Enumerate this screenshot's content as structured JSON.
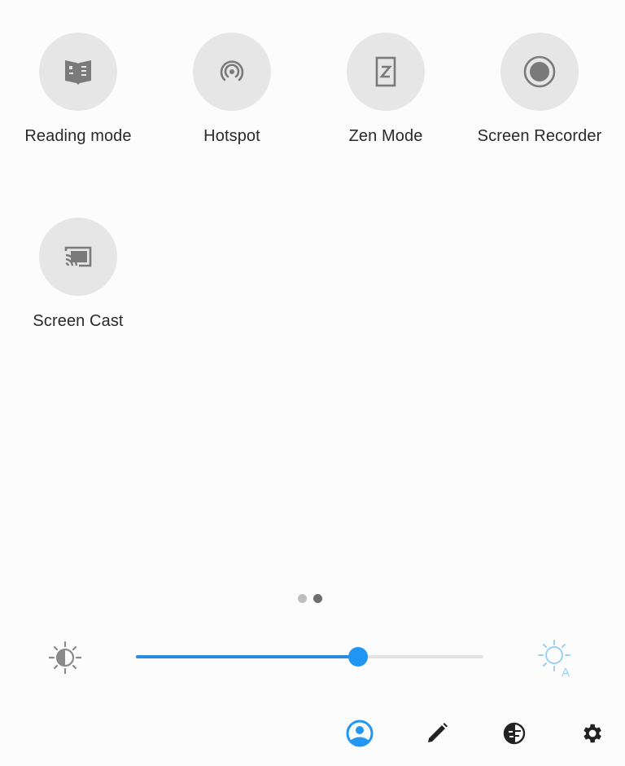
{
  "tiles": [
    {
      "label": "Reading mode",
      "icon": "book-icon"
    },
    {
      "label": "Hotspot",
      "icon": "hotspot-icon"
    },
    {
      "label": "Zen Mode",
      "icon": "zen-mode-icon"
    },
    {
      "label": "Screen Recorder",
      "icon": "record-icon"
    },
    {
      "label": "Screen Cast",
      "icon": "cast-icon"
    }
  ],
  "pager": {
    "page_count": 2,
    "active_page": 2,
    "active_color": "#6e6e6e",
    "inactive_color": "#bdbdbd"
  },
  "brightness": {
    "level_fraction": 0.64,
    "accent_color": "#2196f3",
    "auto_icon_color": "#9ad0f2",
    "auto_label": "A"
  },
  "bottom_bar": [
    {
      "icon": "user-account-icon",
      "color": "#2196f3"
    },
    {
      "icon": "edit-pencil-icon",
      "color": "#222222"
    },
    {
      "icon": "data-saver-icon",
      "color": "#222222"
    },
    {
      "icon": "settings-gear-icon",
      "color": "#222222"
    }
  ],
  "colors": {
    "tile_bg": "#e6e6e6",
    "icon_gray": "#7a7a7a",
    "background": "#fcfcfc"
  }
}
